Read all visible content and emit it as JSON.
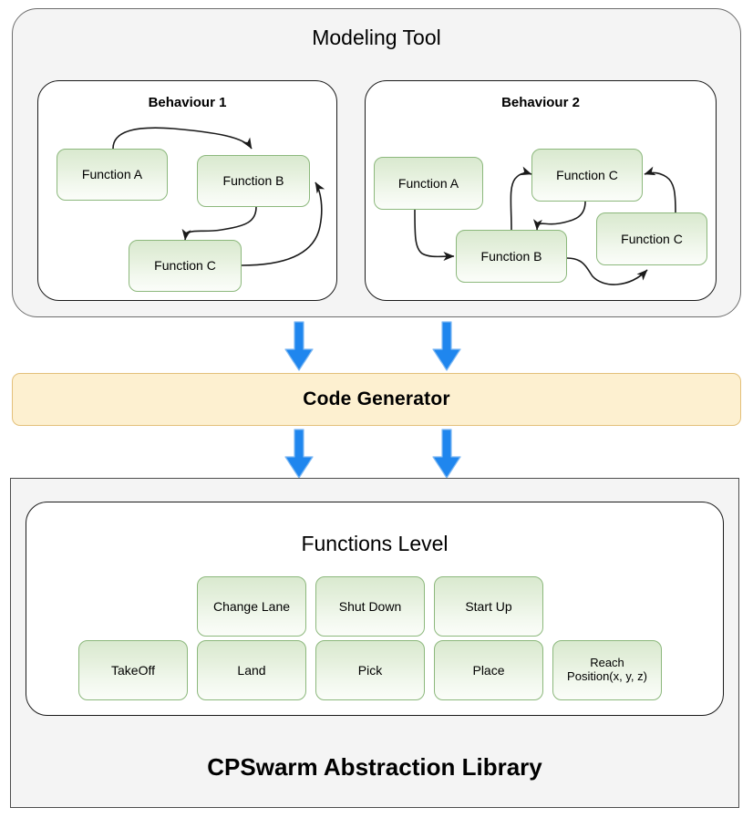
{
  "modeling_tool": {
    "title": "Modeling Tool",
    "behaviours": [
      {
        "title": "Behaviour 1",
        "nodes": [
          {
            "label": "Function A"
          },
          {
            "label": "Function B"
          },
          {
            "label": "Function C"
          }
        ]
      },
      {
        "title": "Behaviour 2",
        "nodes": [
          {
            "label": "Function A"
          },
          {
            "label": "Function C"
          },
          {
            "label": "Function C"
          },
          {
            "label": "Function B"
          }
        ]
      }
    ]
  },
  "code_generator": {
    "label": "Code Generator",
    "fill_color": "#fdf0d0",
    "border_color": "#e3c07a"
  },
  "flow_arrows": {
    "icon": "arrow-down-icon",
    "color": "#1f86ee",
    "count_above": 2,
    "count_below": 2
  },
  "abstraction_library": {
    "title": "CPSwarm Abstraction Library",
    "functions_level": {
      "title": "Functions Level",
      "row_top": [
        {
          "label": "Change Lane"
        },
        {
          "label": "Shut Down"
        },
        {
          "label": "Start Up"
        }
      ],
      "row_bottom": [
        {
          "label": "TakeOff"
        },
        {
          "label": "Land"
        },
        {
          "label": "Pick"
        },
        {
          "label": "Place"
        },
        {
          "label": "Reach",
          "label_line2": "Position(x, y, z)"
        }
      ]
    }
  },
  "colors": {
    "node_border": "#8cb87c",
    "node_fill_top": "#d9e9cf",
    "panel_fill": "#f4f4f4",
    "arrow_blue": "#1f86ee"
  }
}
